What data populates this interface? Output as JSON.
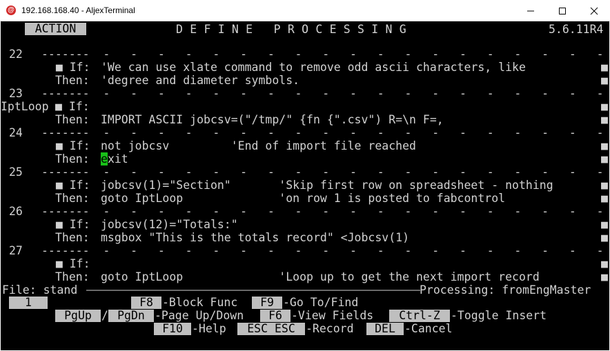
{
  "window": {
    "title": "192.168.168.40 - AljexTerminal",
    "icon": "at-sign-icon"
  },
  "header": {
    "action_label": "ACTION",
    "title": "DEFINE PROCESSING",
    "version": "5.6.11R4"
  },
  "rows": [
    {
      "num": "22",
      "dashes": "-------  -   -   -   -   -   -   -   -   -   -   -   -   -   -   -   -   -   -   -"
    },
    {
      "if_prefix": "  ■ If:",
      "if_text": "'We can use xlate command to remove odd ascii characters, like",
      "then_text": "'degree and diameter symbols."
    },
    {
      "num": "23",
      "dashes": "-------  -   -   -   -   -   -   -   -   -   -   -   -   -   -   -   -   -   -   -"
    },
    {
      "label": "IptLoop",
      "if_prefix": "■ If:",
      "if_text": "",
      "then_text": "IMPORT ASCII jobcsv=(\"/tmp/\" {fn {\".csv\") R=\\n F=,"
    },
    {
      "num": "24",
      "dashes": "-------  -   -   -   -   -   -   -   -   -   -   -   -   -   -   -   -   -   -   -"
    },
    {
      "if_prefix": "  ■ If:",
      "if_text": "not jobcsv         'End of import file reached",
      "then_pre": "",
      "then_cursor": "e",
      "then_post": "xit"
    },
    {
      "num": "25",
      "dashes": "-------  -   -   -   -   -   -   -   -   -   -   -   -   -   -   -   -   -   -   -"
    },
    {
      "if_prefix": "  ■ If:",
      "if_text": "jobcsv(1)=\"Section\"       'Skip first row on spreadsheet - nothing",
      "then_text": "goto IptLoop              'on row 1 is posted to fabcontrol"
    },
    {
      "num": "26",
      "dashes": "-------  -   -   -   -   -   -   -   -   -   -   -   -   -   -   -   -   -   -   -"
    },
    {
      "if_prefix": "  ■ If:",
      "if_text": "jobcsv(12)=\"Totals:\"",
      "then_text": "msgbox \"This is the totals record\" <Jobcsv(1)"
    },
    {
      "num": "27",
      "dashes": "-------  -   -   -   -   -   -   -   -   -   -   -   -   -   -   -   -   -   -   -"
    },
    {
      "if_prefix": "  ■ If:",
      "if_text": "",
      "then_text": "goto IptLoop              'Loop up to get the next import record"
    }
  ],
  "then_prefix": "Then:",
  "right_marker": "■",
  "status": {
    "file_label": "File: stand",
    "processing_label": "Processing: fromEngMaster"
  },
  "footer": {
    "page_number": "1",
    "keys": [
      {
        "key": "F8",
        "label": "-Block Func"
      },
      {
        "key": "F9",
        "label": "-Go To/Find"
      },
      {
        "key": "PgUp",
        "label": "/"
      },
      {
        "key": "PgDn",
        "label": "-Page Up/Down"
      },
      {
        "key": "F6",
        "label": "-View Fields"
      },
      {
        "key": "Ctrl-Z",
        "label": "-Toggle Insert"
      },
      {
        "key": "F10",
        "label": "-Help"
      },
      {
        "key": "ESC ESC",
        "label": "-Record"
      },
      {
        "key": "DEL",
        "label": "-Cancel"
      }
    ]
  },
  "colors": {
    "terminal_bg": "#000000",
    "terminal_fg": "#d2d2d2",
    "keycap_bg": "#bfbfbf",
    "cursor": "#18c018"
  }
}
